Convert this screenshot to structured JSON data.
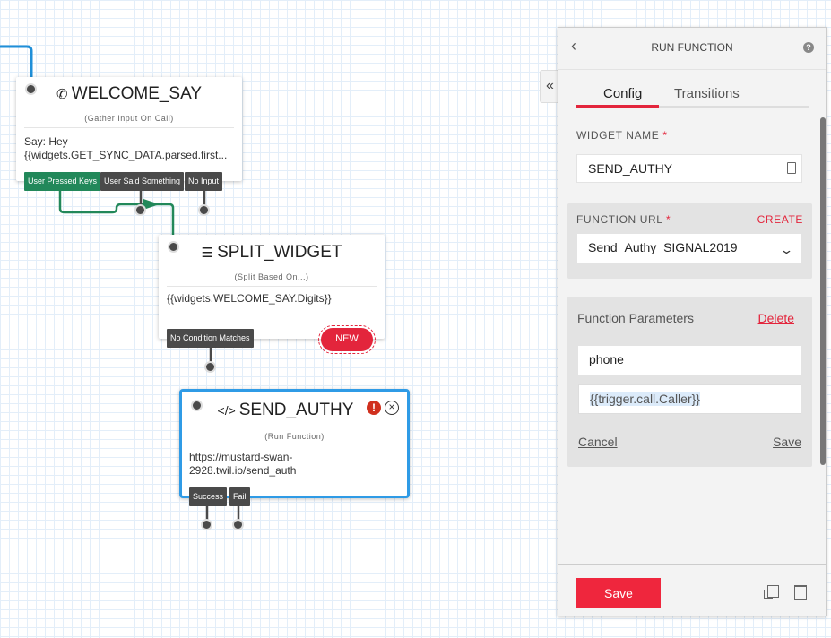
{
  "canvas": {
    "widgets": [
      {
        "name": "WELCOME_SAY",
        "icon": "phone-icon",
        "type": "(Gather Input On Call)",
        "body": [
          "Say: Hey",
          "{{widgets.GET_SYNC_DATA.parsed.first..."
        ],
        "transitions": [
          "User Pressed Keys",
          "User Said Something",
          "No Input"
        ]
      },
      {
        "name": "SPLIT_WIDGET",
        "icon": "split-icon",
        "type": "(Split Based On...)",
        "body": [
          "{{widgets.WELCOME_SAY.Digits}}"
        ],
        "transitions": [
          "No Condition Matches"
        ],
        "new_badge": "NEW"
      },
      {
        "name": "SEND_AUTHY",
        "icon": "code-icon",
        "type": "(Run Function)",
        "body": [
          "https://mustard-swan-",
          "2928.twil.io/send_auth"
        ],
        "transitions": [
          "Success",
          "Fail"
        ],
        "selected": true,
        "has_error": true
      }
    ]
  },
  "panel": {
    "title": "RUN FUNCTION",
    "tabs": [
      {
        "label": "Config",
        "active": true
      },
      {
        "label": "Transitions",
        "active": false
      }
    ],
    "widget_name": {
      "label": "WIDGET NAME",
      "required": "*",
      "value": "SEND_AUTHY"
    },
    "function_url": {
      "label": "FUNCTION URL",
      "required": "*",
      "create": "CREATE",
      "value": "Send_Authy_SIGNAL2019"
    },
    "parameters": {
      "title": "Function Parameters",
      "delete": "Delete",
      "key": "phone",
      "value": "{{trigger.call.Caller}}",
      "cancel": "Cancel",
      "save": "Save"
    },
    "save_button": "Save"
  },
  "colors": {
    "accent": "#e3253c",
    "selected": "#2f9be6",
    "green": "#22885a"
  }
}
